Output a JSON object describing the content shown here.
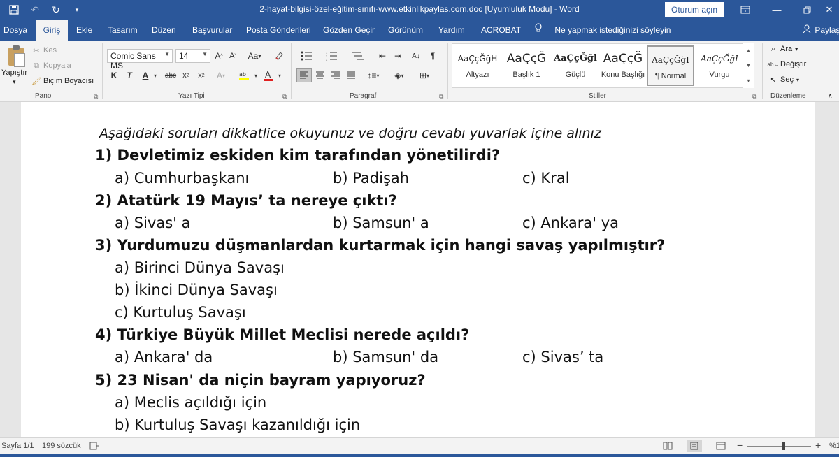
{
  "titlebar": {
    "title": "2-hayat-bilgisi-özel-eğitim-sınıfı-www.etkinlikpaylas.com.doc [Uyumluluk Modu]  -  Word",
    "signin_label": "Oturum açın"
  },
  "tabs": {
    "items": [
      "Dosya",
      "Giriş",
      "Ekle",
      "Tasarım",
      "Düzen",
      "Başvurular",
      "Posta Gönderileri",
      "Gözden Geçir",
      "Görünüm",
      "Yardım",
      "ACROBAT"
    ],
    "active": "Giriş",
    "tell_me": "Ne yapmak istediğinizi söyleyin",
    "share": "Paylaş"
  },
  "ribbon": {
    "clipboard": {
      "paste": "Yapıştır",
      "cut": "Kes",
      "copy": "Kopyala",
      "format_painter": "Biçim Boyacısı",
      "label": "Pano"
    },
    "font": {
      "name": "Comic Sans MS",
      "size": "14",
      "bold": "K",
      "italic": "T",
      "underline": "A",
      "label": "Yazı Tipi"
    },
    "paragraph": {
      "label": "Paragraf"
    },
    "styles": {
      "items": [
        {
          "preview": "AaÇçĞğH",
          "name": "Altyazı"
        },
        {
          "preview": "AaÇçĞ",
          "name": "Başlık 1"
        },
        {
          "preview": "AaÇçĞğl",
          "name": "Güçlü"
        },
        {
          "preview": "AaÇçĞ",
          "name": "Konu Başlığı"
        },
        {
          "preview": "AaÇçĞğI",
          "name": "¶ Normal"
        },
        {
          "preview": "AaÇçĞğI",
          "name": "Vurgu"
        }
      ],
      "selected_index": 4,
      "label": "Stiller"
    },
    "editing": {
      "find": "Ara",
      "replace": "Değiştir",
      "select": "Seç",
      "label": "Düzenleme"
    }
  },
  "document": {
    "instruction": "Aşağıdaki soruları dikkatlice okuyunuz ve doğru cevabı yuvarlak içine alınız",
    "questions": [
      {
        "text": "1) Devletimiz eskiden kim tarafından yönetilirdi?",
        "options": [
          "a) Cumhurbaşkanı",
          "b) Padişah",
          "c) Kral"
        ]
      },
      {
        "text": "2) Atatürk 19 Mayıs’ ta nereye çıktı?",
        "options": [
          "a) Sivas' a",
          "b) Samsun' a",
          "c) Ankara' ya"
        ]
      },
      {
        "text": "3) Yurdumuzu düşmanlardan kurtarmak için hangi savaş yapılmıştır?",
        "options": [
          "a) Birinci Dünya Savaşı",
          "b) İkinci Dünya Savaşı",
          "c) Kurtuluş Savaşı"
        ]
      },
      {
        "text": "4) Türkiye Büyük Millet Meclisi nerede açıldı?",
        "options": [
          "a) Ankara' da",
          "b) Samsun' da",
          "c) Sivas’ ta"
        ]
      },
      {
        "text": "5) 23 Nisan' da niçin bayram yapıyoruz?",
        "options": [
          "a) Meclis açıldığı için",
          "b) Kurtuluş Savaşı kazanıldığı için"
        ]
      }
    ]
  },
  "statusbar": {
    "page": "Sayfa 1/1",
    "words": "199 sözcük",
    "zoom": "%1"
  }
}
